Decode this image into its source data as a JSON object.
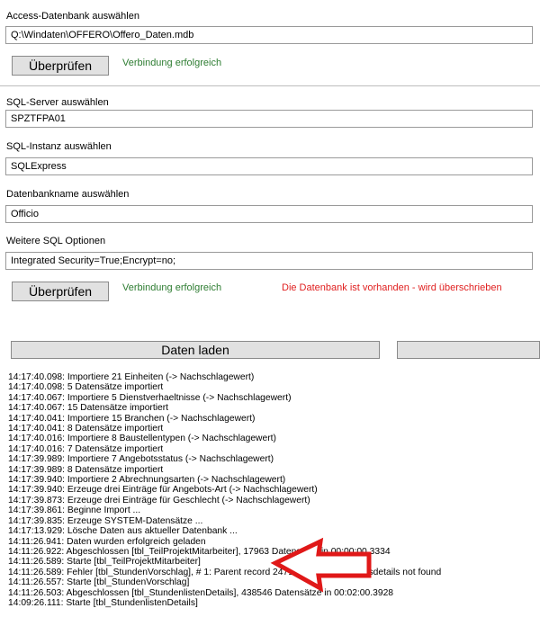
{
  "access": {
    "label": "Access-Datenbank auswählen",
    "path": "Q:\\Windaten\\OFFERO\\Offero_Daten.mdb",
    "check_label": "Überprüfen",
    "status": "Verbindung erfolgreich"
  },
  "sql": {
    "server_label": "SQL-Server auswählen",
    "server_value": "SPZTFPA01",
    "instance_label": "SQL-Instanz auswählen",
    "instance_value": "SQLExpress",
    "dbname_label": "Datenbankname auswählen",
    "dbname_value": "Officio",
    "options_label": "Weitere SQL Optionen",
    "options_value": "Integrated Security=True;Encrypt=no;",
    "check_label": "Überprüfen",
    "status": "Verbindung erfolgreich",
    "warning": "Die Datenbank ist vorhanden - wird überschrieben"
  },
  "load_button": "Daten laden",
  "colors": {
    "ok": "#2e7d32",
    "warning": "#e02020",
    "arrow": "#e01818"
  },
  "log": [
    "14:17:40.098: Importiere 21 Einheiten (-> Nachschlagewert)",
    "14:17:40.098: 5 Datensätze importiert",
    "14:17:40.067: Importiere 5 Dienstverhaeltnisse (-> Nachschlagewert)",
    "14:17:40.067: 15 Datensätze importiert",
    "14:17:40.041: Importiere 15 Branchen (-> Nachschlagewert)",
    "14:17:40.041: 8 Datensätze importiert",
    "14:17:40.016: Importiere 8 Baustellentypen (-> Nachschlagewert)",
    "14:17:40.016: 7 Datensätze importiert",
    "14:17:39.989: Importiere 7 Angebotsstatus (-> Nachschlagewert)",
    "14:17:39.989: 8 Datensätze importiert",
    "14:17:39.940: Importiere 2 Abrechnungsarten (-> Nachschlagewert)",
    "14:17:39.940: Erzeuge drei Einträge für Angebots-Art (-> Nachschlagewert)",
    "14:17:39.873: Erzeuge drei Einträge für Geschlecht (-> Nachschlagewert)",
    "14:17:39.861: Beginne Import ...",
    "14:17:39.835: Erzeuge SYSTEM-Datensätze ...",
    "14:17:13.929: Lösche Daten aus aktueller Datenbank ...",
    "14:11:26.941: Daten wurden erfolgreich geladen",
    "14:11:26.922: Abgeschlossen [tbl_TeilProjektMitarbeiter], 17963 Datensätze in 00:00:00.3334",
    "14:11:26.589: Starte [tbl_TeilProjektMitarbeiter]",
    "14:11:26.589: Fehler [tbl_StundenVorschlag], # 1: Parent record 24717 in table Leistungsdetails not found",
    "14:11:26.557: Starte [tbl_StundenVorschlag]",
    "14:11:26.503: Abgeschlossen [tbl_StundenlistenDetails], 438546 Datensätze in 00:02:00.3928",
    "14:09:26.111: Starte [tbl_StundenlistenDetails]"
  ]
}
